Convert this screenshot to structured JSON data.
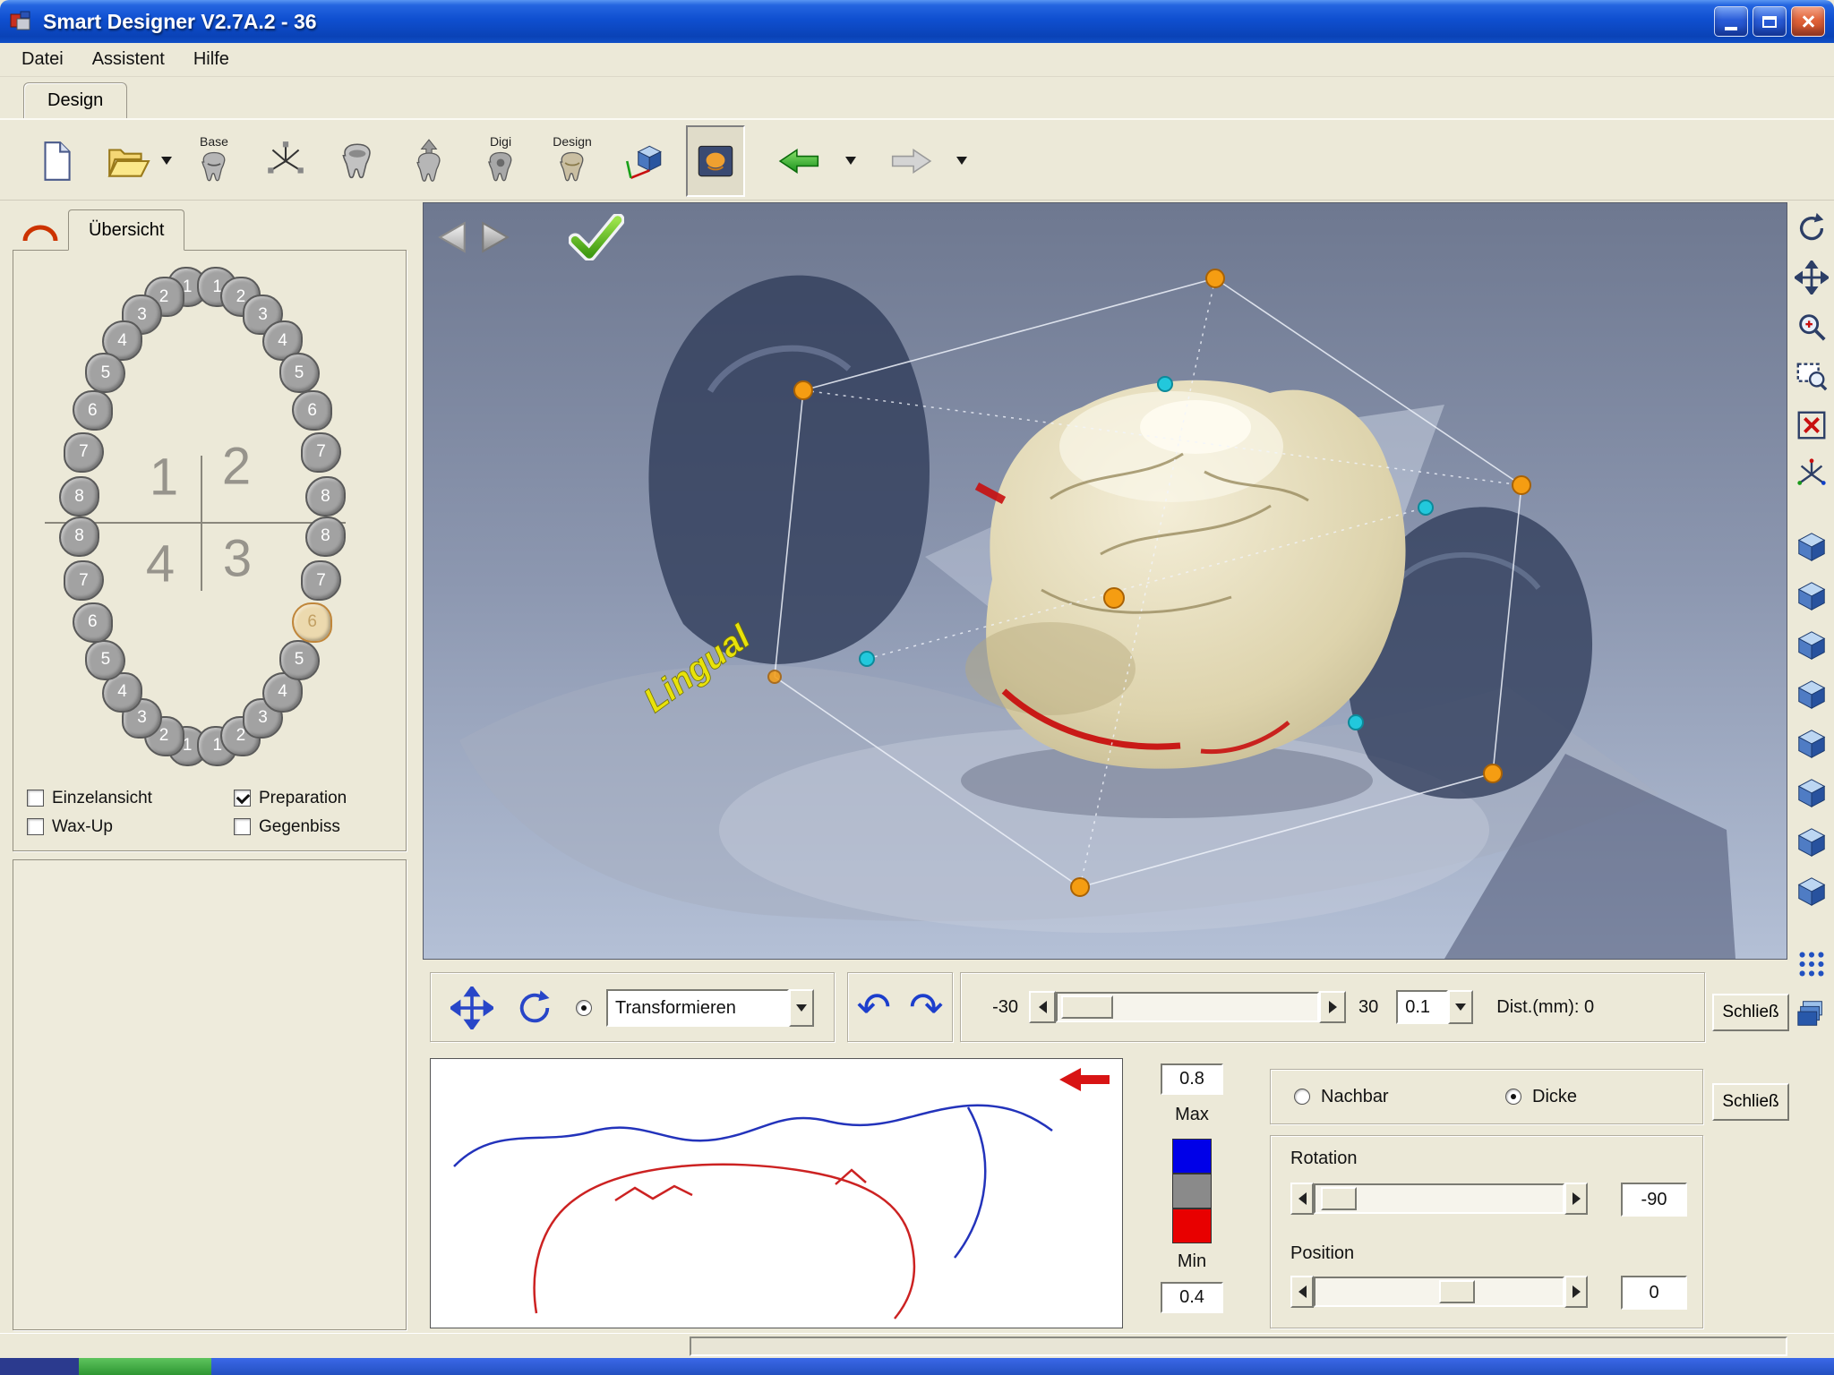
{
  "window": {
    "title": "Smart Designer V2.7A.2 - 36"
  },
  "menu": {
    "items": [
      "Datei",
      "Assistent",
      "Hilfe"
    ]
  },
  "tab": {
    "label": "Design"
  },
  "toolbar": {
    "base_label": "Base",
    "digi_label": "Digi",
    "design_label": "Design"
  },
  "overview": {
    "tab_label": "Übersicht",
    "quadrant_labels": [
      "1",
      "2",
      "4",
      "3"
    ],
    "quadrants": [
      {
        "id": "q1",
        "teeth": [
          "1",
          "2",
          "3",
          "4",
          "5",
          "6",
          "7",
          "8"
        ]
      },
      {
        "id": "q2",
        "teeth": [
          "1",
          "2",
          "3",
          "4",
          "5",
          "6",
          "7",
          "8"
        ]
      },
      {
        "id": "q4",
        "teeth": [
          "1",
          "2",
          "3",
          "4",
          "5",
          "6",
          "7",
          "8"
        ]
      },
      {
        "id": "q3",
        "teeth": [
          "1",
          "2",
          "3",
          "4",
          "5",
          "6",
          "7",
          "8"
        ],
        "highlighted": "6"
      }
    ],
    "checkboxes": [
      {
        "label": "Einzelansicht",
        "checked": false
      },
      {
        "label": "Wax-Up",
        "checked": false
      },
      {
        "label": "Preparation",
        "checked": true
      },
      {
        "label": "Gegenbiss",
        "checked": false
      }
    ]
  },
  "viewport": {
    "lingual_label": "Lingual"
  },
  "transform": {
    "mode_selected": true,
    "combo_value": "Transformieren",
    "range_min": "-30",
    "range_max": "30",
    "step_value": "0.1",
    "distance_label": "Dist.(mm): 0"
  },
  "close_buttons": {
    "first": "Schließ",
    "second": "Schließ"
  },
  "section": {
    "max_value": "0.8",
    "max_label": "Max",
    "min_label": "Min",
    "min_value": "0.4",
    "legend_colors": [
      "#0000e8",
      "#8a8a8a",
      "#e80000"
    ]
  },
  "adjust": {
    "options": [
      {
        "label": "Nachbar",
        "selected": false
      },
      {
        "label": "Dicke",
        "selected": true
      }
    ],
    "rotation_label": "Rotation",
    "rotation_value": "-90",
    "position_label": "Position",
    "position_value": "0"
  },
  "right_toolbar": {
    "icons": [
      {
        "name": "rotate-view-icon",
        "icon": "rotate"
      },
      {
        "name": "pan-view-icon",
        "icon": "pan"
      },
      {
        "name": "zoom-in-icon",
        "icon": "zoom"
      },
      {
        "name": "zoom-window-icon",
        "icon": "zoomwin"
      },
      {
        "name": "reset-view-icon",
        "icon": "reset"
      },
      {
        "name": "axes-icon",
        "icon": "axes"
      },
      {
        "name": "view-cube-top-icon",
        "icon": "cube",
        "gap": true
      },
      {
        "name": "view-cube-bottom-icon",
        "icon": "cube"
      },
      {
        "name": "view-cube-front-icon",
        "icon": "cube"
      },
      {
        "name": "view-cube-back-icon",
        "icon": "cube"
      },
      {
        "name": "view-cube-left-icon",
        "icon": "cube"
      },
      {
        "name": "view-cube-right-icon",
        "icon": "cube"
      },
      {
        "name": "view-cube-iso1-icon",
        "icon": "cube"
      },
      {
        "name": "view-cube-iso2-icon",
        "icon": "cube"
      },
      {
        "name": "grid-icon",
        "icon": "grid",
        "gap": true
      },
      {
        "name": "layers-icon",
        "icon": "layers"
      }
    ]
  }
}
